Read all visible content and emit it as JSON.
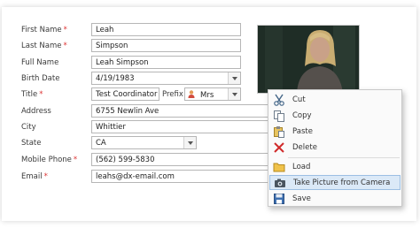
{
  "form": {
    "fields": [
      {
        "id": "first-name",
        "label": "First Name",
        "required": true,
        "value": "Leah"
      },
      {
        "id": "last-name",
        "label": "Last Name",
        "required": true,
        "value": "Simpson"
      },
      {
        "id": "full-name",
        "label": "Full Name",
        "required": false,
        "value": "Leah Simpson"
      },
      {
        "id": "birth-date",
        "label": "Birth Date",
        "required": false,
        "value": "4/19/1983"
      },
      {
        "id": "title",
        "label": "Title",
        "required": true,
        "value": "Test Coordinator"
      },
      {
        "id": "address",
        "label": "Address",
        "required": false,
        "value": "6755 Newlin Ave"
      },
      {
        "id": "city",
        "label": "City",
        "required": false,
        "value": "Whittier"
      },
      {
        "id": "state",
        "label": "State",
        "required": false,
        "value": "CA"
      },
      {
        "id": "mobile-phone",
        "label": "Mobile Phone",
        "required": true,
        "value": "(562) 599-5830"
      },
      {
        "id": "email",
        "label": "Email",
        "required": true,
        "value": "leahs@dx-email.com"
      }
    ],
    "prefix": {
      "label": "Prefix",
      "value": "Mrs",
      "icon": "person-icon"
    },
    "required_marker": "*"
  },
  "context_menu": {
    "items": [
      {
        "label": "Cut",
        "icon": "scissors-icon"
      },
      {
        "label": "Copy",
        "icon": "copy-icon"
      },
      {
        "label": "Paste",
        "icon": "paste-icon"
      },
      {
        "label": "Delete",
        "icon": "delete-icon"
      },
      {
        "label": "Load",
        "icon": "folder-icon"
      },
      {
        "label": "Take Picture from Camera",
        "icon": "camera-icon",
        "highlighted": true
      },
      {
        "label": "Save",
        "icon": "save-icon"
      }
    ]
  },
  "colors": {
    "required": "#d33333",
    "highlight": "#dbe9f7",
    "highlight_border": "#9cbfe3"
  }
}
